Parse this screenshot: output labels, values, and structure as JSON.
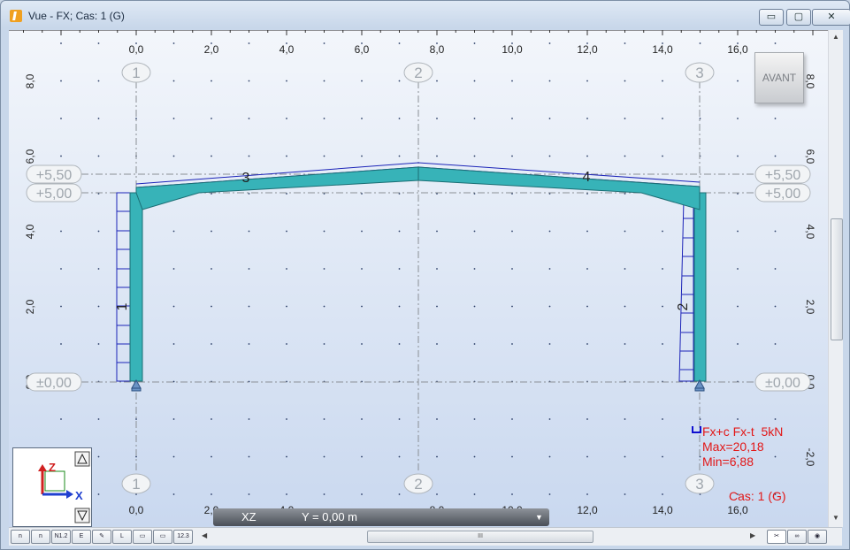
{
  "window": {
    "title": "Vue - FX; Cas: 1 (G)",
    "buttons": {
      "minimize": "▭",
      "maximize": "▢",
      "close": "✕"
    }
  },
  "view": {
    "x_ticks": [
      "0,0",
      "2,0",
      "4,0",
      "6,0",
      "8,0",
      "10,0",
      "12,0",
      "14,0",
      "16,0"
    ],
    "z_ticks": [
      "8,0",
      "6,0",
      "4,0",
      "2,0",
      "0,0",
      "-2,0"
    ],
    "grid_labels": [
      "1",
      "2",
      "3"
    ],
    "levels": [
      "+5,50",
      "+5,00",
      "±0,00"
    ],
    "members": [
      "1",
      "2",
      "3",
      "4"
    ],
    "avant_label": "AVANT",
    "axis_labels": {
      "z": "Z",
      "x": "X"
    }
  },
  "legend": {
    "line1": "Fx+c Fx-t  5kN",
    "line2": "Max=20,18",
    "line3": "Min=6,88"
  },
  "case_label": "Cas: 1 (G)",
  "bottom_panel": {
    "plane": "XZ",
    "position": "Y = 0,00 m"
  },
  "toolbar": {
    "buttons": [
      "n",
      "n",
      "N1.2",
      "E",
      "✎",
      "L",
      "▭",
      "▭",
      "12.3"
    ],
    "scroll_grip": "III"
  },
  "colors": {
    "member_fill": "#37b3b8",
    "diagram_blue": "#1c24b8",
    "annotation_red": "#e21818",
    "label_grey": "#9fa6ad"
  }
}
